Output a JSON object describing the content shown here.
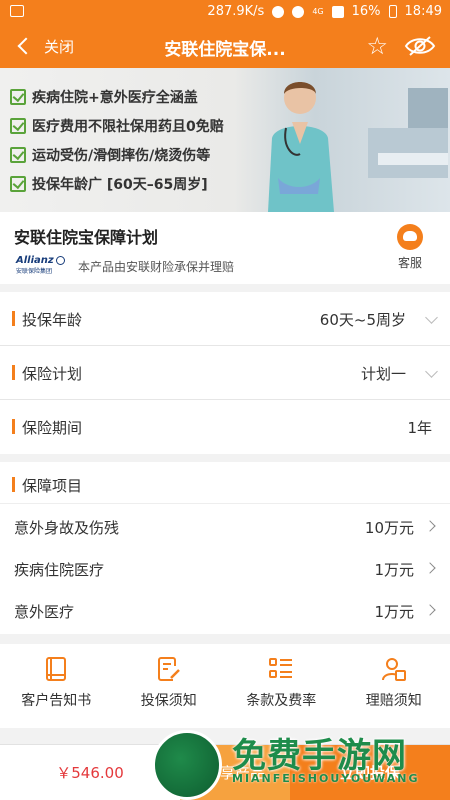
{
  "status_bar": {
    "speed": "287.9K/s",
    "network": "4G",
    "battery": "16%",
    "time": "18:49"
  },
  "nav": {
    "back_label": "关闭",
    "title": "安联住院宝保..."
  },
  "banner": {
    "benefits": [
      "疾病住院+意外医疗全涵盖",
      "医疗费用不限社保用药且0免赔",
      "运动受伤/滑倒摔伤/烧烫伤等",
      "投保年龄广 [60天–65周岁]"
    ]
  },
  "product": {
    "name": "安联住院宝保障计划",
    "insurer_logo_text": "Allianz",
    "insurer_logo_sub": "安联保险集团",
    "underwriter_note": "本产品由安联财险承保并理赔",
    "service_label": "客服"
  },
  "form": {
    "age": {
      "label": "投保年龄",
      "value": "60天~5周岁"
    },
    "plan": {
      "label": "保险计划",
      "value": "计划一"
    },
    "period": {
      "label": "保险期间",
      "value": "1年"
    }
  },
  "coverage": {
    "title": "保障项目",
    "items": [
      {
        "name": "意外身故及伤残",
        "amount": "10万元"
      },
      {
        "name": "疾病住院医疗",
        "amount": "1万元"
      },
      {
        "name": "意外医疗",
        "amount": "1万元"
      }
    ]
  },
  "links": [
    {
      "label": "客户告知书",
      "icon": "book-icon"
    },
    {
      "label": "投保须知",
      "icon": "document-edit-icon"
    },
    {
      "label": "条款及费率",
      "icon": "list-icon"
    },
    {
      "label": "理赔须知",
      "icon": "claim-person-icon"
    }
  ],
  "bottom": {
    "price": "￥546.00",
    "share_label": "分享产品",
    "buy_label": "立即投保"
  },
  "watermark": {
    "text": "免费手游网",
    "sub": "MIANFEISHOUYOUWANG"
  },
  "colors": {
    "brand_orange": "#f47f1c",
    "share_orange": "#f6a23f",
    "price_red": "#e4393c",
    "check_green": "#5aa33a"
  }
}
